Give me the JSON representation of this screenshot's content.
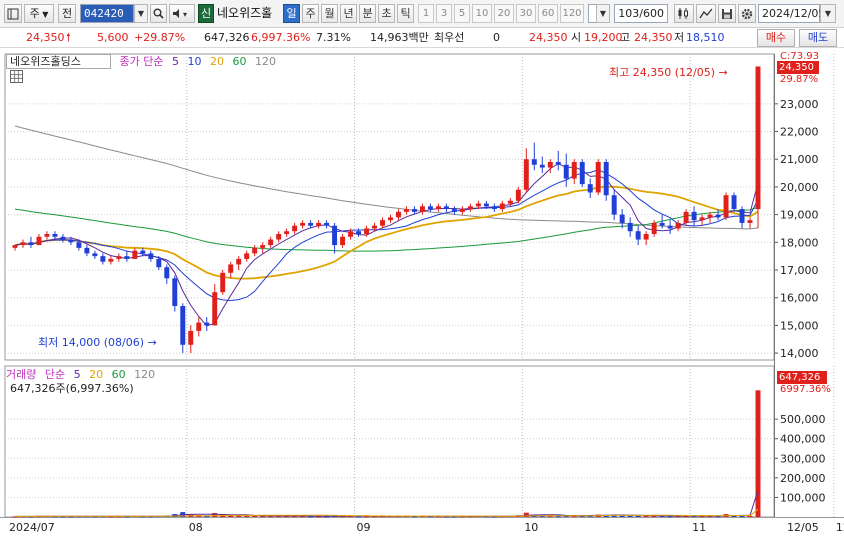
{
  "toolbar": {
    "market_type": "주",
    "jeon_label": "전",
    "stock_code": "042420",
    "sin_badge": "신",
    "stock_name": "네오위즈홀",
    "periods": [
      "일",
      "주",
      "월",
      "년",
      "분",
      "초",
      "틱"
    ],
    "active_period": "일",
    "intervals": [
      "1",
      "3",
      "5",
      "10",
      "20",
      "30",
      "60",
      "120"
    ],
    "count": "103/600",
    "date": "2024/12/05"
  },
  "quote": {
    "price": "24,350",
    "change": "5,600",
    "change_pct": "+29.87%",
    "volume": "647,326",
    "volume_pct": "6,997.36%",
    "turnover_pct": "7.31%",
    "amount": "14,963백만",
    "priority_label": "최우선",
    "priority_value": "0",
    "ask_price": "24,350",
    "open_label": "시",
    "open": "19,200",
    "high_label": "고",
    "high": "24,350",
    "low_label": "저",
    "low": "18,510",
    "buy_label": "매수",
    "sell_label": "매도"
  },
  "colors": {
    "up": "#e0201b",
    "down": "#1f3fd6",
    "ma5": "#5a2a9c",
    "ma10": "#1f3fd6",
    "ma20": "#e0a400",
    "ma60": "#1a9a3a",
    "ma120": "#8a8a8a"
  },
  "price_panel": {
    "legend_name": "네오위즈홀딩스",
    "legend_type": "종가 단순",
    "ma_periods": [
      "5",
      "10",
      "20",
      "60",
      "120"
    ],
    "top_label": "C:73.93",
    "current_tag": "24,350",
    "pct_tag": "29.87%",
    "high_annotation": "최고 24,350 (12/05)",
    "low_annotation": "최저 14,000 (08/06)"
  },
  "volume_panel": {
    "legend_name": "거래량",
    "legend_type": "단순",
    "ma_periods": [
      "5",
      "20",
      "60",
      "120"
    ],
    "info": "647,326주(6,997.36%)",
    "current_tag": "647,326",
    "pct_tag": "6997.36%"
  },
  "x_axis": {
    "labels": [
      "2024/07",
      "08",
      "09",
      "10",
      "11",
      "12",
      "12/05"
    ]
  },
  "chart_data": {
    "type": "candlestick",
    "price_axis": {
      "ticks": [
        "14,000",
        "15,000",
        "16,000",
        "17,000",
        "18,000",
        "19,000",
        "20,000",
        "21,000",
        "22,000",
        "23,000"
      ],
      "range": [
        13750,
        24800
      ]
    },
    "volume_axis": {
      "ticks": [
        "100,000",
        "200,000",
        "300,000",
        "400,000",
        "500,000"
      ],
      "range": [
        0,
        700000
      ]
    },
    "candles": [
      [
        17800,
        17900,
        17700,
        17900,
        3000
      ],
      [
        17900,
        18100,
        17800,
        18000,
        3500
      ],
      [
        18000,
        18200,
        17800,
        17900,
        3000
      ],
      [
        17900,
        18300,
        17900,
        18200,
        4000
      ],
      [
        18200,
        18400,
        18100,
        18300,
        4500
      ],
      [
        18300,
        18400,
        18100,
        18200,
        3500
      ],
      [
        18200,
        18300,
        18000,
        18100,
        3000
      ],
      [
        18100,
        18200,
        17900,
        18000,
        3000
      ],
      [
        18000,
        18100,
        17700,
        17800,
        4000
      ],
      [
        17800,
        17900,
        17500,
        17600,
        4000
      ],
      [
        17600,
        17700,
        17400,
        17500,
        3500
      ],
      [
        17500,
        17600,
        17200,
        17300,
        4000
      ],
      [
        17300,
        17500,
        17200,
        17400,
        3000
      ],
      [
        17400,
        17600,
        17300,
        17500,
        3500
      ],
      [
        17500,
        17700,
        17300,
        17400,
        3000
      ],
      [
        17400,
        17800,
        17400,
        17700,
        5000
      ],
      [
        17700,
        17800,
        17500,
        17600,
        3500
      ],
      [
        17600,
        17700,
        17300,
        17400,
        3500
      ],
      [
        17400,
        17500,
        17000,
        17100,
        5000
      ],
      [
        17100,
        17200,
        16500,
        16700,
        7000
      ],
      [
        16700,
        16800,
        15500,
        15700,
        15000
      ],
      [
        15700,
        15800,
        14000,
        14300,
        25000
      ],
      [
        14300,
        15000,
        14000,
        14800,
        15000
      ],
      [
        14800,
        15300,
        14600,
        15100,
        9000
      ],
      [
        15100,
        15300,
        14800,
        15000,
        6000
      ],
      [
        15000,
        16500,
        15000,
        16200,
        20000
      ],
      [
        16200,
        17000,
        16100,
        16900,
        14000
      ],
      [
        16900,
        17300,
        16700,
        17200,
        8000
      ],
      [
        17200,
        17500,
        17000,
        17400,
        7000
      ],
      [
        17400,
        17700,
        17300,
        17600,
        6000
      ],
      [
        17600,
        17900,
        17500,
        17800,
        6000
      ],
      [
        17800,
        18000,
        17600,
        17900,
        5000
      ],
      [
        17900,
        18200,
        17800,
        18100,
        6000
      ],
      [
        18100,
        18400,
        18000,
        18300,
        6000
      ],
      [
        18300,
        18500,
        18200,
        18400,
        5000
      ],
      [
        18400,
        18700,
        18300,
        18600,
        6000
      ],
      [
        18600,
        18800,
        18500,
        18700,
        5000
      ],
      [
        18700,
        18800,
        18500,
        18600,
        4000
      ],
      [
        18600,
        18800,
        18500,
        18700,
        4000
      ],
      [
        18700,
        18800,
        18500,
        18600,
        3500
      ],
      [
        18600,
        18700,
        17600,
        17900,
        8000
      ],
      [
        17900,
        18300,
        17800,
        18200,
        6000
      ],
      [
        18200,
        18500,
        18100,
        18400,
        5000
      ],
      [
        18400,
        18500,
        18200,
        18300,
        4000
      ],
      [
        18300,
        18600,
        18200,
        18500,
        4000
      ],
      [
        18500,
        18700,
        18400,
        18600,
        4000
      ],
      [
        18600,
        18900,
        18500,
        18800,
        5000
      ],
      [
        18800,
        19000,
        18700,
        18900,
        5000
      ],
      [
        18900,
        19200,
        18800,
        19100,
        6000
      ],
      [
        19100,
        19300,
        19000,
        19200,
        5000
      ],
      [
        19200,
        19300,
        19000,
        19100,
        4000
      ],
      [
        19100,
        19400,
        19000,
        19300,
        5000
      ],
      [
        19300,
        19400,
        19100,
        19200,
        4000
      ],
      [
        19200,
        19400,
        19100,
        19300,
        4000
      ],
      [
        19300,
        19400,
        19100,
        19200,
        3500
      ],
      [
        19200,
        19300,
        19000,
        19100,
        3500
      ],
      [
        19100,
        19300,
        19000,
        19200,
        3500
      ],
      [
        19200,
        19400,
        19100,
        19300,
        4000
      ],
      [
        19300,
        19500,
        19200,
        19400,
        5000
      ],
      [
        19400,
        19500,
        19200,
        19300,
        4000
      ],
      [
        19300,
        19400,
        19100,
        19200,
        3500
      ],
      [
        19200,
        19500,
        19100,
        19400,
        4000
      ],
      [
        19400,
        19600,
        19300,
        19500,
        5000
      ],
      [
        19500,
        20000,
        19400,
        19900,
        9000
      ],
      [
        19900,
        21400,
        19800,
        21000,
        22000
      ],
      [
        21000,
        21600,
        20600,
        20800,
        12000
      ],
      [
        20800,
        21100,
        20500,
        20700,
        8000
      ],
      [
        20700,
        21000,
        20500,
        20900,
        6000
      ],
      [
        20900,
        21300,
        20600,
        20800,
        7000
      ],
      [
        20800,
        21200,
        20000,
        20300,
        9000
      ],
      [
        20300,
        21000,
        20100,
        20900,
        7000
      ],
      [
        20900,
        21000,
        20000,
        20100,
        7000
      ],
      [
        20100,
        20300,
        19600,
        19800,
        9000
      ],
      [
        19800,
        21000,
        19700,
        20900,
        12000
      ],
      [
        20900,
        21000,
        19500,
        19700,
        10000
      ],
      [
        19700,
        19900,
        18800,
        19000,
        12000
      ],
      [
        19000,
        19200,
        18500,
        18700,
        8000
      ],
      [
        18700,
        18900,
        18200,
        18400,
        7000
      ],
      [
        18400,
        18600,
        17900,
        18100,
        7000
      ],
      [
        18100,
        18400,
        17900,
        18300,
        5000
      ],
      [
        18300,
        18800,
        18200,
        18700,
        6000
      ],
      [
        18700,
        19000,
        18500,
        18600,
        5000
      ],
      [
        18600,
        18800,
        18300,
        18500,
        4000
      ],
      [
        18500,
        18800,
        18400,
        18700,
        5000
      ],
      [
        18700,
        19200,
        18600,
        19100,
        8000
      ],
      [
        19100,
        19300,
        18600,
        18800,
        6000
      ],
      [
        18800,
        19000,
        18600,
        18900,
        5000
      ],
      [
        18900,
        19100,
        18700,
        19000,
        5000
      ],
      [
        19000,
        19200,
        18800,
        18900,
        4000
      ],
      [
        18900,
        19800,
        18800,
        19700,
        15000
      ],
      [
        19700,
        19800,
        19100,
        19200,
        9000
      ],
      [
        19200,
        19300,
        18500,
        18700,
        8000
      ],
      [
        18700,
        18900,
        18500,
        18800,
        6000
      ],
      [
        19200,
        24350,
        18510,
        24350,
        647326
      ]
    ]
  }
}
